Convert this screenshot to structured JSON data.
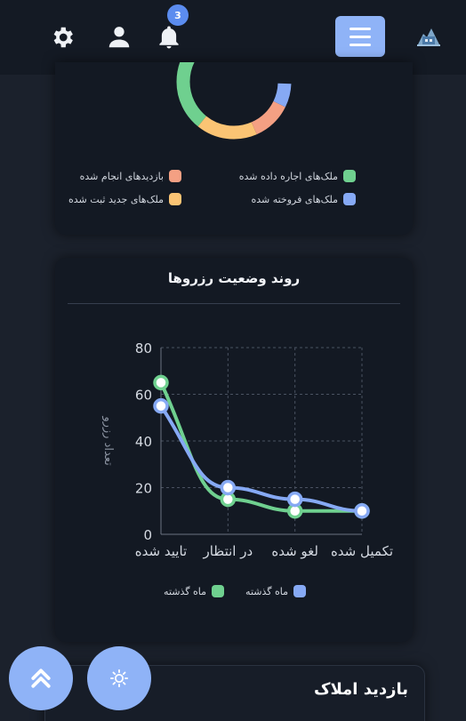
{
  "header": {
    "notification_count": "3",
    "icons": [
      "settings-icon",
      "user-icon",
      "bell-icon",
      "menu-icon",
      "logo"
    ]
  },
  "donut": {
    "legend": [
      {
        "label": "ملک‌های اجاره داده شده",
        "color": "#6fd08f"
      },
      {
        "label": "بازدیدهای انجام شده",
        "color": "#f4a083"
      },
      {
        "label": "ملک‌های فروخته شده",
        "color": "#86a9f4"
      },
      {
        "label": "ملک‌های جدید ثبت شده",
        "color": "#fbc474"
      }
    ]
  },
  "trend": {
    "title": "روند وضعیت رزروها",
    "legend": [
      {
        "label": "ماه گذشته",
        "color": "#86a9f4"
      },
      {
        "label": "ماه گذشته",
        "color": "#6fd08f"
      }
    ]
  },
  "chart_data": {
    "type": "line",
    "categories": [
      "تایید شده",
      "در انتظار",
      "لغو شده",
      "تکمیل شده"
    ],
    "ylabel": "تعداد رزرو",
    "ylim": [
      0,
      80
    ],
    "yticks": [
      "0",
      "20",
      "40",
      "60",
      "80"
    ],
    "grid": true,
    "series": [
      {
        "name": "ماه گذشته",
        "color": "#6fd08f",
        "values": [
          65,
          15,
          10,
          10
        ]
      },
      {
        "name": "ماه گذشته",
        "color": "#86a9f4",
        "values": [
          55,
          20,
          15,
          10
        ]
      }
    ]
  },
  "visits": {
    "title": "بازدید املاک"
  }
}
